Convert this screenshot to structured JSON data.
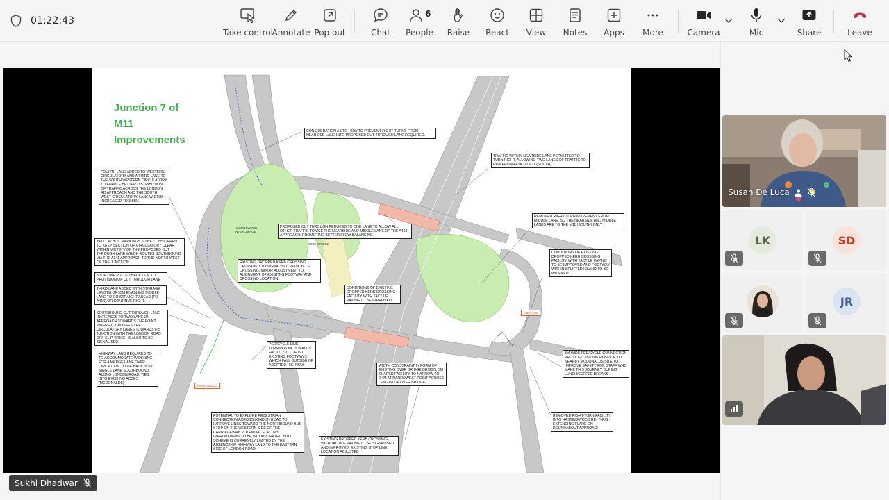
{
  "meeting": {
    "timer": "01:22:43"
  },
  "toolbar": {
    "take_control": "Take control",
    "annotate": "Annotate",
    "pop_out": "Pop out",
    "chat": "Chat",
    "people": "People",
    "people_count": "6",
    "raise": "Raise",
    "react": "React",
    "view": "View",
    "notes": "Notes",
    "apps": "Apps",
    "more": "More",
    "camera": "Camera",
    "mic": "Mic",
    "share": "Share",
    "leave": "Leave"
  },
  "colors": {
    "leave_red": "#c4314b",
    "title_green": "#3cb44b",
    "road_grey": "#c8c8c8",
    "grass_green": "#c9ecb0",
    "tag_orange": "#e0662a"
  },
  "presenter": {
    "name": "Sukhi Dhadwar"
  },
  "slide": {
    "title": "Junction 7 of\nM11\nImprovements",
    "notes": [
      "Consideration as to how to prevent right turns from nearside lane into proposed cut through lane required.",
      "Traffic within nearside lane permitted to turn right, allowing two lanes of traffic to run from A414 to M11 (South)",
      "Fourth lane added to western circulatory and a third lane to the south western circulatory to enable better distribution of traffic across the London Rd approach and the south west circulatory. Lane widths increased to 3.65m.",
      "Removed right-turn movement from middle lane, so the nearside and middle lanes are to the M11 (South) only",
      "Proposed cut through reduced to one lane to allow all other traffic to use the nearside and middle lane of the A414 approach, promoting better flow balancing.",
      "Yellow box markings to be considered to keep section of circulatory clear within vicinity of the proposed cut through lane which routes southbound via the A141 approach to the north west of the junction",
      "Conditions of existing dropped kerb crossing facility with tactile paving to be improved and footway within splitter island to be widened.",
      "Existing dropped kerb crossing upgraded to signalised ped/cycle crossing. Minor adjustment to alignment of existing footway and crossing location.",
      "Stop line pulled back due to provision of cut through lane",
      "Third lane added with storage length of 55m enabling middle lane to go straight ahead (to A414) or continue right.",
      "Conditions of existing dropped kerb crossing facility with tactile paving to be improved.",
      "Southbound cut through lane increases to two lane on approach towards the point where it crosses the circulatory lanes towards its junction with the London Road off-slip, which is also to be signalised.",
      "Ped/cycle link towards McDonalds facility to tie into existing footways which fall outside of adopted highway",
      "Highway land required to to accommodate widening for a merge lane over circa 100m to tie back into single lane southbound along London Road. Ties into existing acces (McDonalds)",
      "Width constraint in form of existing over bridge design. 3m shared facility to narrow to 2.4m at narrowest point across length of over bridge.",
      "3m wide ped/cycle connection provided to link hospice to nearby McDonalds site to improve safety for staff who make this journey during lunch/coffee breaks",
      "Potential to explore pedestrian connection across London Road to improve links toward the northbound bus stop on the western side of the carriageway.\n\nPotential for this improvement to be incorporated into scheme is currently limited by the absence of highway land to the eastern side of London Road.",
      "Removed right-turn facility into Hastingwood Rd, thus extending flare on roundabout approach",
      "Existing dropped kerb crossing with tactile paving to be signalised and improved. Existing stop line location adjusted"
    ],
    "labels": {
      "hospice": "Hospice",
      "mcdonalds": "McDonalds",
      "interchange": "Hastingwood\nInterchange",
      "weighbridge": "Weighbridge"
    }
  },
  "participants": [
    {
      "name": "Susan De Luca",
      "muted": true
    },
    {
      "initials": "LK",
      "muted": true
    },
    {
      "initials": "SD",
      "muted": true
    },
    {
      "muted": true
    },
    {
      "initials": "JR",
      "muted": true
    },
    {
      "muted": false
    }
  ]
}
